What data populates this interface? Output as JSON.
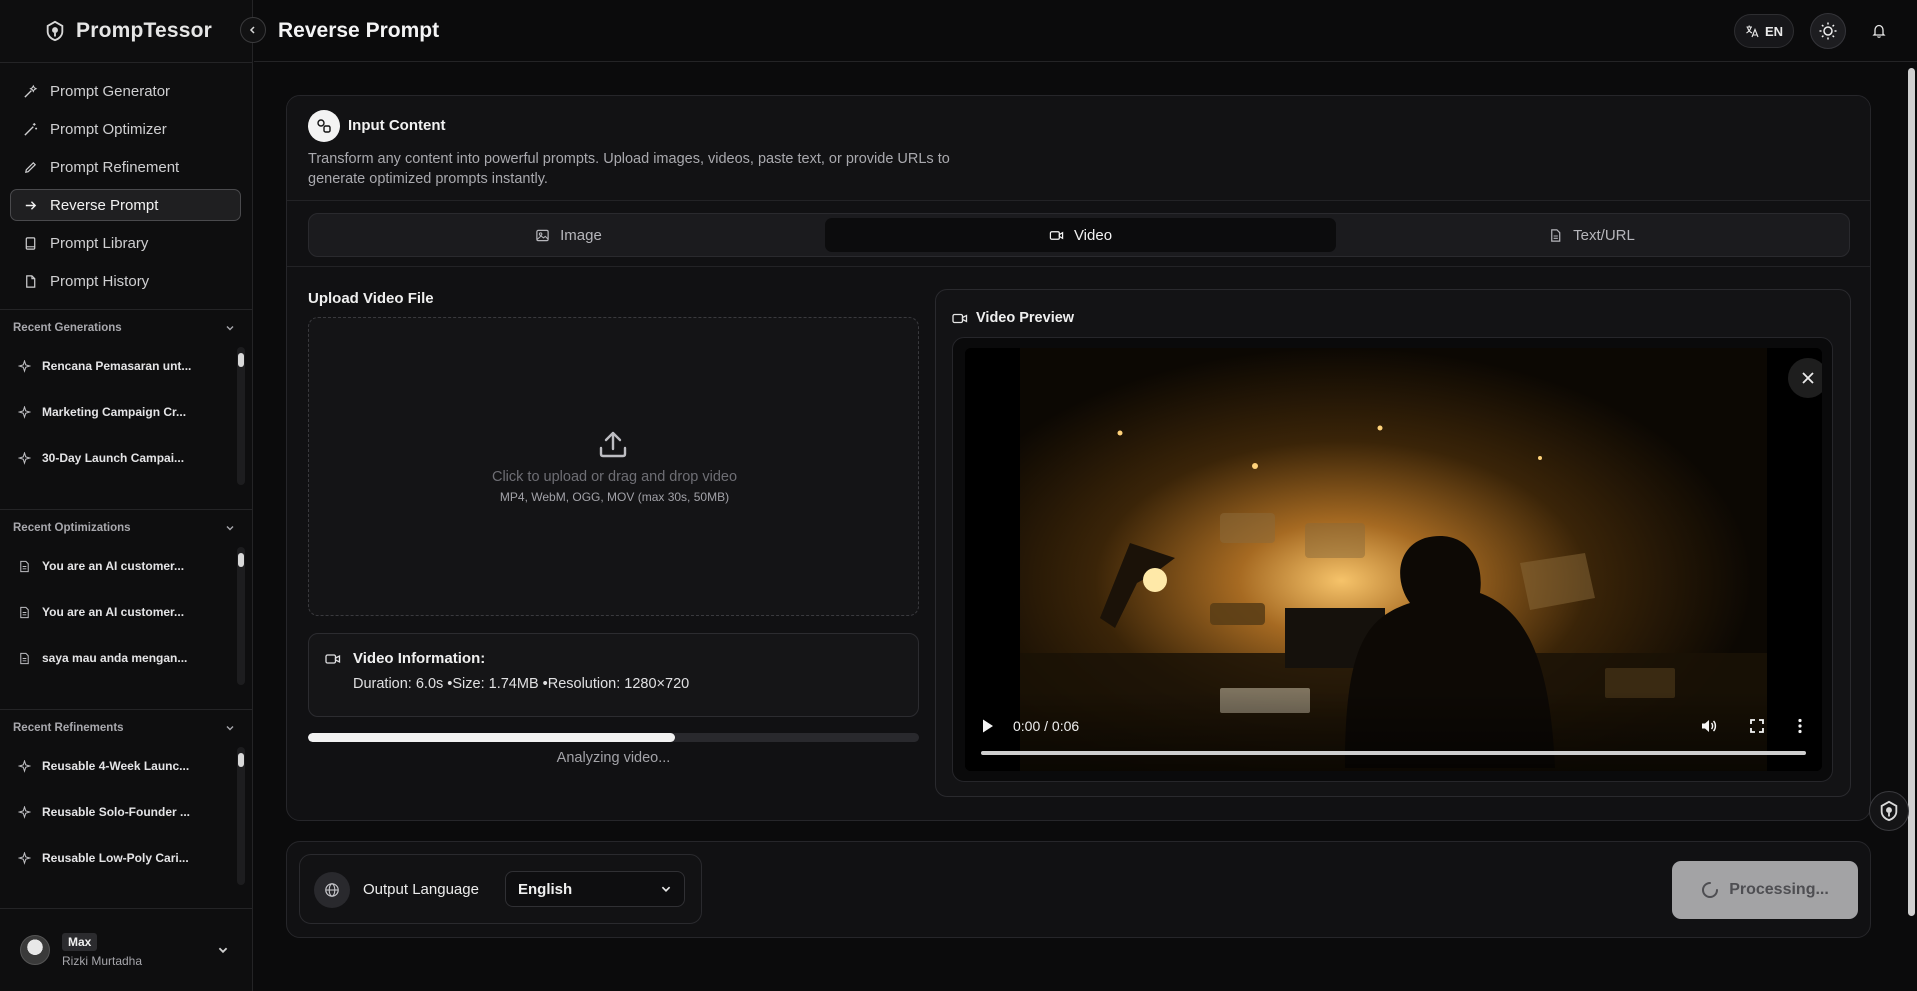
{
  "brand": {
    "name": "PrompTessor"
  },
  "header": {
    "title": "Reverse Prompt",
    "lang": "EN"
  },
  "nav": [
    {
      "label": "Prompt Generator",
      "icon": "sparkles-wand-icon"
    },
    {
      "label": "Prompt Optimizer",
      "icon": "magic-wand-icon"
    },
    {
      "label": "Prompt Refinement",
      "icon": "pencil-icon"
    },
    {
      "label": "Reverse Prompt",
      "icon": "arrow-right-icon",
      "active": true
    },
    {
      "label": "Prompt Library",
      "icon": "book-icon"
    },
    {
      "label": "Prompt History",
      "icon": "document-icon"
    }
  ],
  "sections": {
    "generations": {
      "title": "Recent Generations",
      "items": [
        "Rencana Pemasaran unt...",
        "Marketing Campaign Cr...",
        "30-Day Launch Campai..."
      ]
    },
    "optimizations": {
      "title": "Recent Optimizations",
      "items": [
        "You are an AI customer...",
        "You are an AI customer...",
        "saya mau anda mengan..."
      ]
    },
    "refinements": {
      "title": "Recent Refinements",
      "items": [
        "Reusable 4-Week Launc...",
        "Reusable Solo-Founder ...",
        "Reusable Low-Poly Cari..."
      ]
    }
  },
  "user": {
    "badge": "Max",
    "name": "Rizki Murtadha"
  },
  "card": {
    "title": "Input Content",
    "description": "Transform any content into powerful prompts. Upload images, videos, paste text, or provide URLs to generate optimized prompts instantly.",
    "tabs": [
      {
        "label": "Image",
        "icon": "image-icon"
      },
      {
        "label": "Video",
        "icon": "video-icon",
        "active": true
      },
      {
        "label": "Text/URL",
        "icon": "document-icon"
      }
    ]
  },
  "upload": {
    "label": "Upload Video File",
    "prompt": "Click to upload or drag and drop video",
    "formats": "MP4, WebM, OGG, MOV (max 30s, 50MB)"
  },
  "video_info": {
    "title": "Video Information:",
    "details": "Duration: 6.0s •Size: 1.74MB •Resolution: 1280×720"
  },
  "progress": {
    "fraction": 0.6,
    "label": "Analyzing video..."
  },
  "preview": {
    "title": "Video Preview",
    "time": "0:00 / 0:06"
  },
  "output": {
    "label": "Output Language",
    "language": "English"
  },
  "action": {
    "label": "Processing..."
  },
  "colors": {
    "background": "#0b0b0c",
    "surface": "#111113",
    "accent": "#f2f2f2",
    "button_disabled": "#a3a3a5"
  }
}
